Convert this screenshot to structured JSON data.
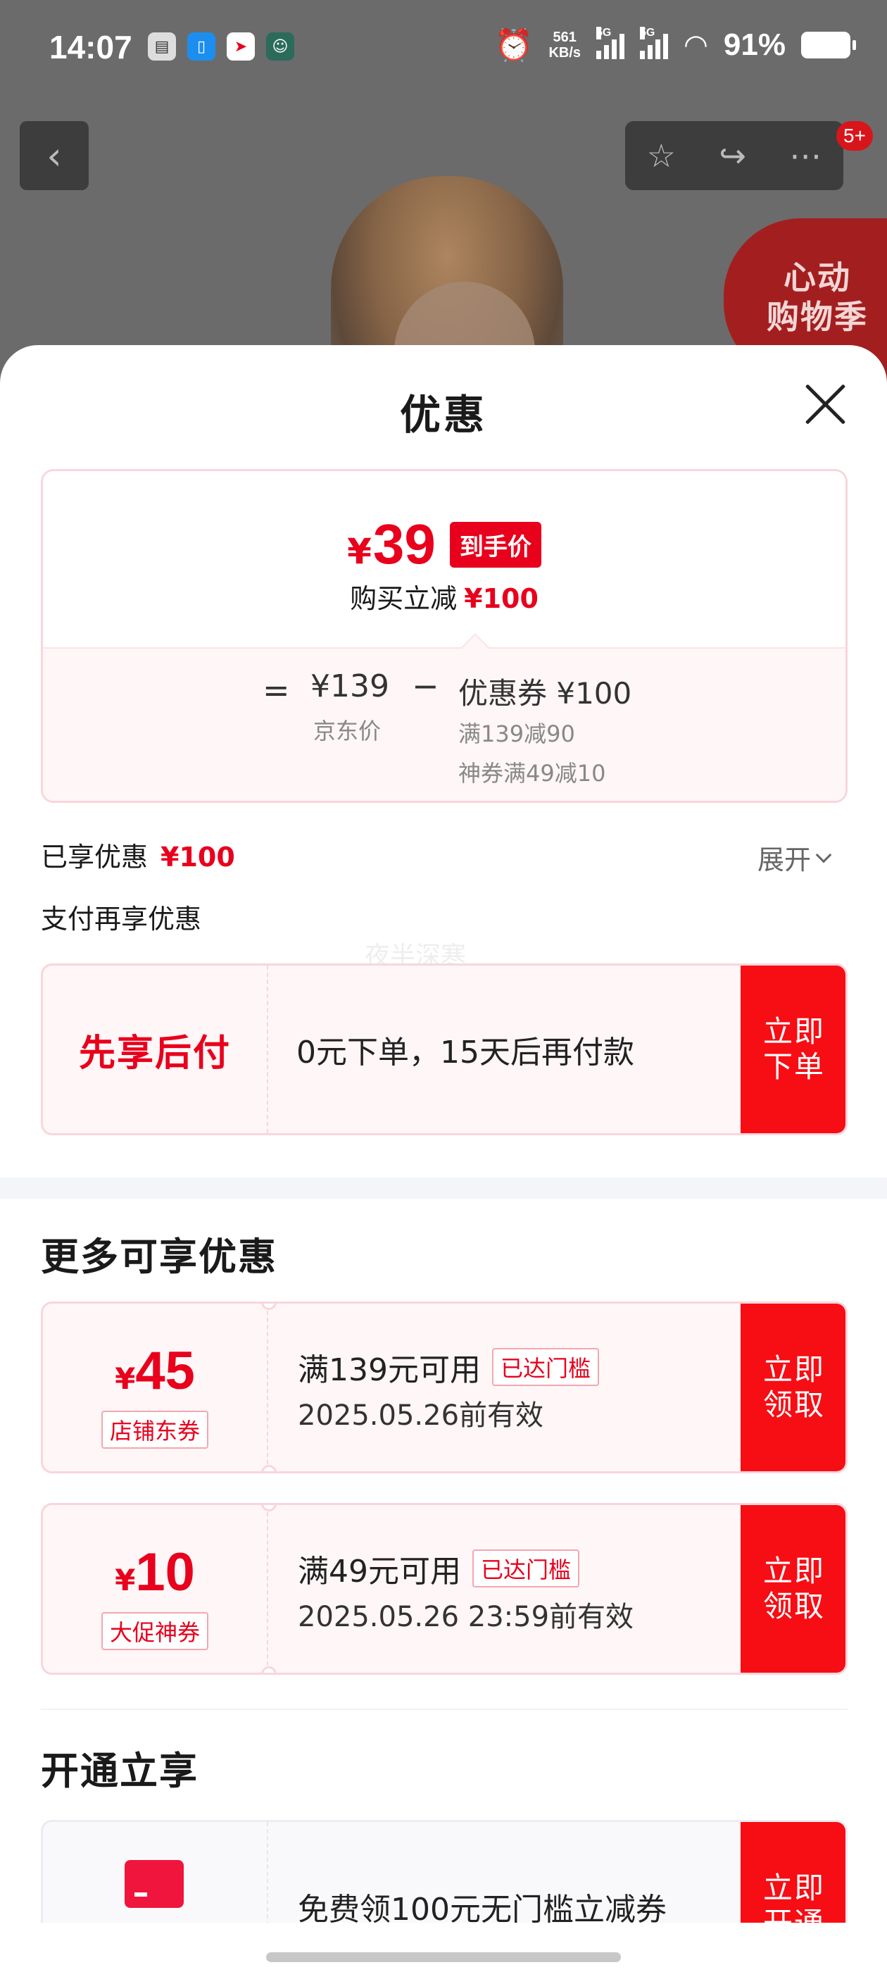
{
  "status_bar": {
    "time": "14:07",
    "app_icons": [
      "app-icon-1",
      "app-icon-2",
      "app-icon-3",
      "app-icon-4"
    ],
    "alarm_icon": "alarm-icon",
    "net_speed_value": "561",
    "net_speed_unit": "KB/s",
    "signal_1": "5G",
    "signal_2": "5G",
    "battery_percent": "91%"
  },
  "background": {
    "badge_line1": "心动",
    "badge_line2": "购物季",
    "notification_count": "5+"
  },
  "sheet": {
    "title": "优惠",
    "price_card": {
      "yen": "¥",
      "final_price": "39",
      "final_price_tag": "到手价",
      "reduction_label": "购买立减",
      "reduction_amount": "¥100",
      "equals": "=",
      "jd_price": "¥139",
      "jd_price_label": "京东价",
      "minus": "−",
      "coupon_total": "优惠券 ¥100",
      "coupon_detail_1": "满139减90",
      "coupon_detail_2": "神券满49减10"
    },
    "enjoyed_label": "已享优惠",
    "enjoyed_amount": "¥100",
    "expand_label": "展开",
    "pay_more_label": "支付再享优惠",
    "watermark": "夜半深寒",
    "pay_later": {
      "title": "先享后付",
      "description": "0元下单，15天后再付款",
      "button_line1": "立即",
      "button_line2": "下单"
    },
    "more_title": "更多可享优惠",
    "coupons": [
      {
        "yen": "¥",
        "amount": "45",
        "type": "店铺东券",
        "condition": "满139元可用",
        "status": "已达门槛",
        "validity": "2025.05.26前有效",
        "button_line1": "立即",
        "button_line2": "领取"
      },
      {
        "yen": "¥",
        "amount": "10",
        "type": "大促神券",
        "condition": "满49元可用",
        "status": "已达门槛",
        "validity": "2025.05.26 23:59前有效",
        "button_line1": "立即",
        "button_line2": "领取"
      }
    ],
    "open_title": "开通立享",
    "open_offer": {
      "icon": "card-icon",
      "description": "免费领100元无门槛立减券",
      "button_line1": "立即",
      "button_line2": "开通"
    }
  },
  "colors": {
    "accent_red": "#e8001c",
    "button_red": "#f70d14",
    "card_bg": "#fff6f7",
    "card_border": "#f8d6dc"
  }
}
